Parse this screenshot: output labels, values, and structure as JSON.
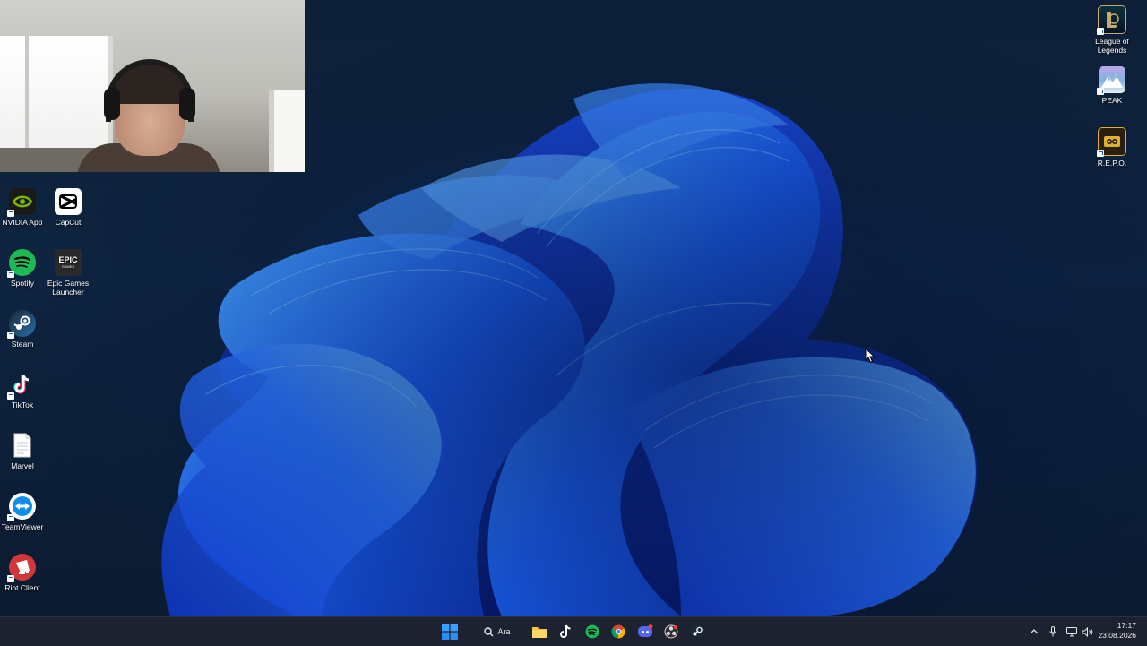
{
  "desktop": {
    "icons_left": [
      {
        "label": "NVIDIA App",
        "icon": "nvidia-icon",
        "color": "#76b900"
      },
      {
        "label": "CapCut",
        "icon": "capcut-icon",
        "color": "#ffffff"
      },
      {
        "label": "Spotify",
        "icon": "spotify-icon",
        "color": "#1db954"
      },
      {
        "label": "Epic Games Launcher",
        "icon": "epic-games-icon",
        "color": "#2a2a2a"
      },
      {
        "label": "Steam",
        "icon": "steam-icon",
        "color": "#1b2838"
      },
      {
        "label": "TikTok",
        "icon": "tiktok-icon",
        "color": "#000000"
      },
      {
        "label": "Marvel",
        "icon": "document-icon",
        "color": "#ffffff"
      },
      {
        "label": "TeamViewer",
        "icon": "teamviewer-icon",
        "color": "#0e8ee9"
      },
      {
        "label": "Riot Client",
        "icon": "riot-icon",
        "color": "#d13639"
      }
    ],
    "icons_right": [
      {
        "label": "League of Legends",
        "icon": "league-of-legends-icon",
        "color": "#c8aa6e"
      },
      {
        "label": "PEAK",
        "icon": "peak-icon",
        "color": "#7fb3e0"
      },
      {
        "label": "R.E.P.O.",
        "icon": "repo-icon",
        "color": "#e0b030"
      }
    ],
    "epic_tile_text": "EPIC",
    "epic_tile_subtext": "GAMES"
  },
  "taskbar": {
    "search_label": "Ara",
    "apps": [
      "start-icon",
      "search-icon",
      "file-explorer-icon",
      "tiktok-icon",
      "spotify-icon",
      "chrome-icon",
      "discord-icon",
      "obs-icon",
      "steam-icon"
    ],
    "tray": [
      "chevron-up-icon",
      "microphone-icon",
      "network-icon",
      "volume-icon"
    ],
    "time": "17:17",
    "date": "23.08.2026"
  },
  "colors": {
    "accent": "#0078d4",
    "wallpaper_bloom": "#1f5fe8"
  }
}
